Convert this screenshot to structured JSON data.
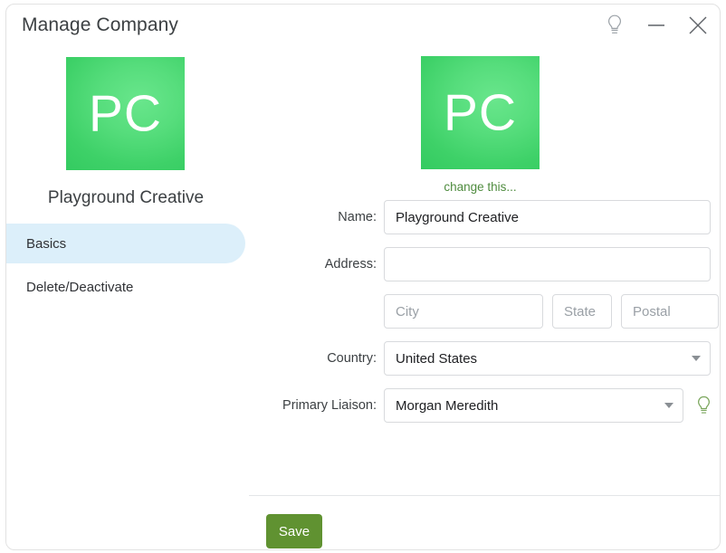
{
  "window": {
    "title": "Manage Company",
    "controls": [
      {
        "name": "help-bulb-icon",
        "icon": "lightbulb-icon",
        "label": ""
      },
      {
        "name": "minimize-button",
        "icon": "minimize-icon",
        "label": ""
      },
      {
        "name": "close-button",
        "icon": "close-icon",
        "label": ""
      }
    ]
  },
  "sidebar": {
    "logo": {
      "initials": "PC",
      "color_start": "#69e68c",
      "color_end": "#2ec75c"
    },
    "company_name": "Playground Creative",
    "items": [
      {
        "label": "Basics",
        "selected": true
      },
      {
        "label": "Delete/Deactivate",
        "selected": false
      }
    ],
    "selected_color": "#dceffa"
  },
  "main": {
    "logo": {
      "initials": "PC"
    },
    "change_logo_link": "change this...",
    "change_logo_color": "#4f8c3f",
    "fields": {
      "name": {
        "label": "Name:",
        "value": "Playground Creative",
        "placeholder": ""
      },
      "address": {
        "label": "Address:",
        "value": "",
        "placeholder": ""
      },
      "city": {
        "value": "",
        "placeholder": "City"
      },
      "state": {
        "value": "",
        "placeholder": "State"
      },
      "postal": {
        "value": "",
        "placeholder": "Postal"
      },
      "country": {
        "label": "Country:",
        "value": "United States"
      },
      "liaison": {
        "label": "Primary Liaison:",
        "value": "Morgan Meredith"
      }
    },
    "liaison_hint_icon": "lightbulb-icon",
    "save": {
      "label": "Save",
      "color": "#609231"
    }
  }
}
